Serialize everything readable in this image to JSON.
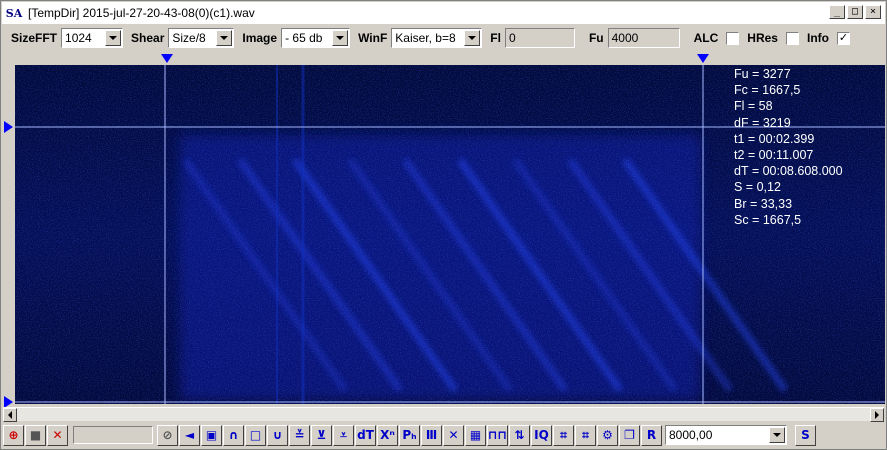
{
  "window": {
    "app_icon": "SA",
    "title": "[TempDir] 2015-jul-27-20-43-08(0)(c1).wav",
    "buttons": {
      "minimize": "_",
      "maximize": "□",
      "close": "×"
    }
  },
  "controls": {
    "sizefft": {
      "label": "SizeFFT",
      "value": "1024"
    },
    "shear": {
      "label": "Shear",
      "value": "Size/8"
    },
    "image": {
      "label": "Image",
      "value": "- 65 db"
    },
    "winf": {
      "label": "WinF",
      "value": "Kaiser, b=8"
    },
    "fl": {
      "label": "Fl",
      "value": "0"
    },
    "fu": {
      "label": "Fu",
      "value": "4000"
    },
    "alc": {
      "label": "ALC",
      "checked": false
    },
    "hres": {
      "label": "HRes",
      "checked": false
    },
    "info": {
      "label": "Info",
      "checked": true,
      "mark": "✓"
    }
  },
  "info_overlay": [
    "Fu = 3277",
    "Fc = 1667,5",
    "Fl = 58",
    "dF = 3219",
    "t1 = 00:02.399",
    "t2 = 00:11.007",
    "dT = 00:08.608.000",
    "S = 0,12",
    "Br = 33,33",
    "Sc = 1667,5"
  ],
  "bottom": {
    "buttons": [
      {
        "name": "zoom-icon",
        "glyph": "⊕"
      },
      {
        "name": "camera-icon",
        "glyph": "■"
      },
      {
        "name": "delete-icon",
        "glyph": "✕"
      }
    ],
    "tools": [
      {
        "name": "stop-icon",
        "glyph": "⊘"
      },
      {
        "name": "speaker-icon",
        "glyph": "◄"
      },
      {
        "name": "frame-icon",
        "glyph": "▣"
      },
      {
        "name": "arc-icon",
        "glyph": "∩"
      },
      {
        "name": "square-icon",
        "glyph": "□"
      },
      {
        "name": "cup-icon",
        "glyph": "∪"
      },
      {
        "name": "marker-a-icon",
        "glyph": "≚"
      },
      {
        "name": "marker-b-icon",
        "glyph": "⊻"
      },
      {
        "name": "marker-c-icon",
        "glyph": "⩡"
      },
      {
        "name": "dt-icon",
        "glyph": "dT"
      },
      {
        "name": "xn-icon",
        "glyph": "Xⁿ"
      },
      {
        "name": "ph-icon",
        "glyph": "Pₕ"
      },
      {
        "name": "comb-icon",
        "glyph": "Ⅲ"
      },
      {
        "name": "cross-icon",
        "glyph": "✕"
      },
      {
        "name": "grid-icon",
        "glyph": "▦"
      },
      {
        "name": "pulse-icon",
        "glyph": "⊓⊓"
      },
      {
        "name": "updown-icon",
        "glyph": "⇅"
      },
      {
        "name": "iq-icon",
        "glyph": "IQ"
      },
      {
        "name": "pattern-a-icon",
        "glyph": "⌗"
      },
      {
        "name": "pattern-b-icon",
        "glyph": "⌗"
      },
      {
        "name": "gear-icon",
        "glyph": "⚙"
      },
      {
        "name": "copy-icon",
        "glyph": "❐"
      },
      {
        "name": "r-icon",
        "glyph": "R"
      }
    ],
    "rate": {
      "value": "8000,00"
    },
    "s_button": "S"
  },
  "colors": {
    "spectrogram_bg": "#000a30",
    "cursor": "#a8b8ff",
    "marker": "#0000ff"
  }
}
